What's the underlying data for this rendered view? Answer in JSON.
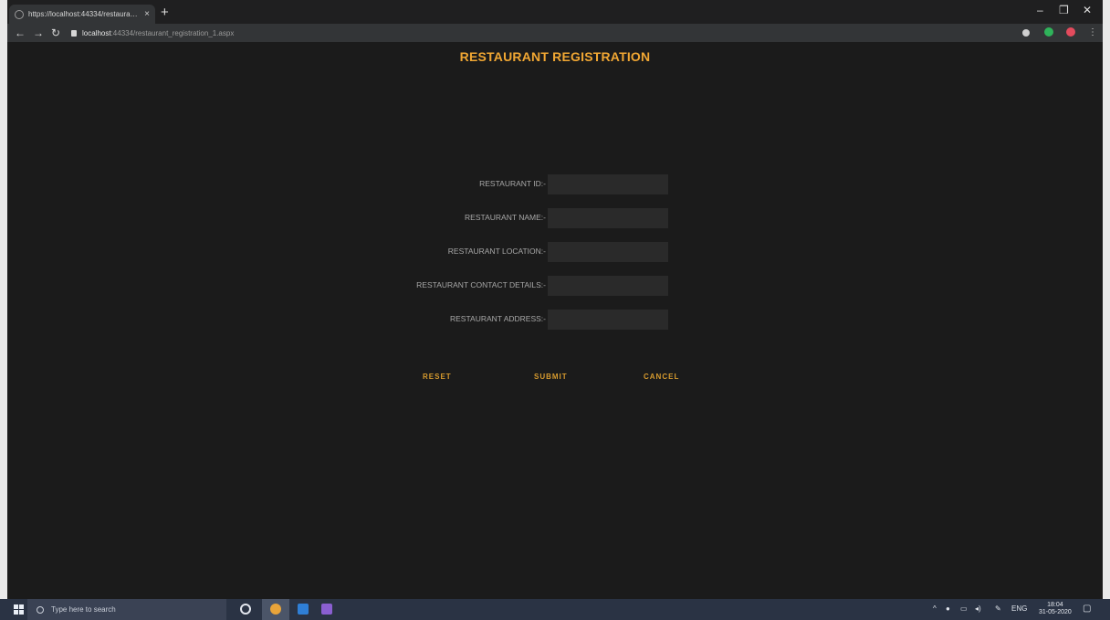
{
  "browser": {
    "tab_title": "https://localhost:44334/restaurant...",
    "tab_close": "×",
    "new_tab": "+",
    "url_host": "localhost",
    "url_path": ":44334/restaurant_registration_1.aspx",
    "window_controls": [
      "–",
      "❐",
      "✕"
    ],
    "nav_icons": [
      "back-arrow",
      "forward-arrow",
      "reload"
    ]
  },
  "page": {
    "title": "RESTAURANT REGISTRATION",
    "fields": [
      {
        "label": "RESTAURANT ID:-",
        "value": ""
      },
      {
        "label": "RESTAURANT NAME:-",
        "value": ""
      },
      {
        "label": "RESTAURANT LOCATION:-",
        "value": ""
      },
      {
        "label": "RESTAURANT CONTACT DETAILS:-",
        "value": ""
      },
      {
        "label": "RESTAURANT ADDRESS:-",
        "value": ""
      }
    ],
    "buttons": {
      "reset": "RESET",
      "submit": "SUBMIT",
      "cancel": "CANCEL"
    }
  },
  "taskbar": {
    "search_placeholder": "Type here to search",
    "time": "18:04",
    "date": "31-05-2020",
    "lang": "ENG"
  },
  "colors": {
    "title": "#f1a733",
    "buttons": "#d69a2e",
    "page_background": "#1b1b1b"
  }
}
